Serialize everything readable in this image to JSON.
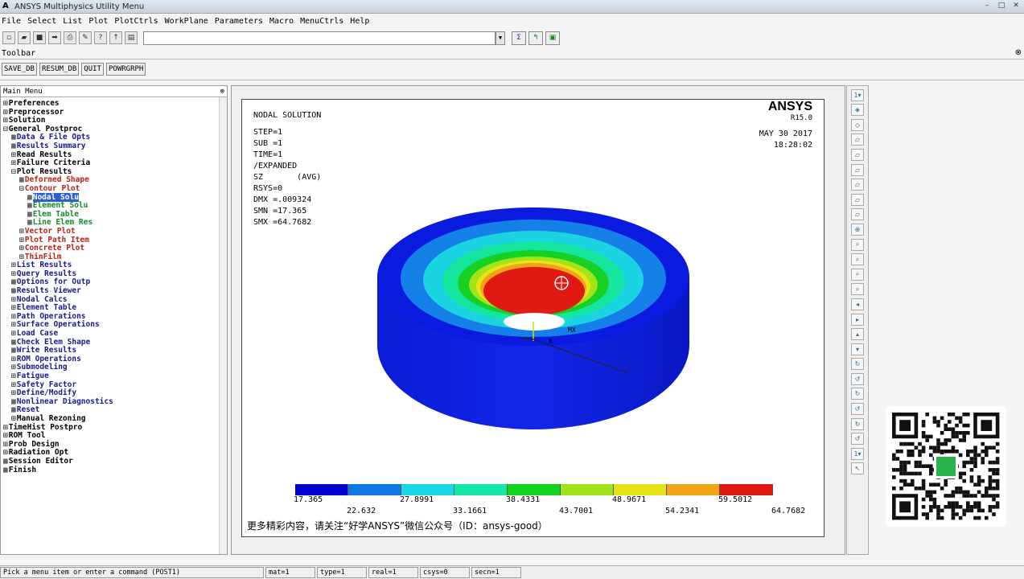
{
  "window": {
    "title": "ANSYS Multiphysics Utility Menu",
    "logo": "A"
  },
  "menubar": [
    "File",
    "Select",
    "List",
    "Plot",
    "PlotCtrls",
    "WorkPlane",
    "Parameters",
    "Macro",
    "MenuCtrls",
    "Help"
  ],
  "toolbar": {
    "label": "Toolbar",
    "buttons": [
      "SAVE_DB",
      "RESUM_DB",
      "QUIT",
      "POWRGRPH"
    ]
  },
  "main_menu": {
    "title": "Main Menu",
    "items": [
      {
        "label": "Preferences",
        "level": 0,
        "prefix": "⊞",
        "style": "c1"
      },
      {
        "label": "Preprocessor",
        "level": 0,
        "prefix": "⊞",
        "style": "c1"
      },
      {
        "label": "Solution",
        "level": 0,
        "prefix": "⊞",
        "style": "c1"
      },
      {
        "label": "General Postproc",
        "level": 0,
        "prefix": "⊟",
        "style": "c1"
      },
      {
        "label": "Data & File Opts",
        "level": 1,
        "prefix": "▦",
        "style": "blue"
      },
      {
        "label": "Results Summary",
        "level": 1,
        "prefix": "▦",
        "style": "blue"
      },
      {
        "label": "Read Results",
        "level": 1,
        "prefix": "⊞",
        "style": "c1"
      },
      {
        "label": "Failure Criteria",
        "level": 1,
        "prefix": "⊞",
        "style": "c1"
      },
      {
        "label": "Plot Results",
        "level": 1,
        "prefix": "⊟",
        "style": "c1"
      },
      {
        "label": "Deformed Shape",
        "level": 2,
        "prefix": "▦",
        "style": "red"
      },
      {
        "label": "Contour Plot",
        "level": 2,
        "prefix": "⊟",
        "style": "red"
      },
      {
        "label": "Nodal Solu",
        "level": 3,
        "prefix": "▦",
        "style": "sel"
      },
      {
        "label": "Element Solu",
        "level": 3,
        "prefix": "▦",
        "style": "green"
      },
      {
        "label": "Elem Table",
        "level": 3,
        "prefix": "▦",
        "style": "green"
      },
      {
        "label": "Line Elem Res",
        "level": 3,
        "prefix": "▦",
        "style": "green"
      },
      {
        "label": "Vector Plot",
        "level": 2,
        "prefix": "⊞",
        "style": "red"
      },
      {
        "label": "Plot Path Item",
        "level": 2,
        "prefix": "⊞",
        "style": "red"
      },
      {
        "label": "Concrete Plot",
        "level": 2,
        "prefix": "⊞",
        "style": "red"
      },
      {
        "label": "ThinFilm",
        "level": 2,
        "prefix": "⊞",
        "style": "red"
      },
      {
        "label": "List Results",
        "level": 1,
        "prefix": "⊞",
        "style": "blue"
      },
      {
        "label": "Query Results",
        "level": 1,
        "prefix": "⊞",
        "style": "blue"
      },
      {
        "label": "Options for Outp",
        "level": 1,
        "prefix": "▦",
        "style": "blue"
      },
      {
        "label": "Results Viewer",
        "level": 1,
        "prefix": "▦",
        "style": "blue"
      },
      {
        "label": "Nodal Calcs",
        "level": 1,
        "prefix": "⊞",
        "style": "blue"
      },
      {
        "label": "Element Table",
        "level": 1,
        "prefix": "⊞",
        "style": "blue"
      },
      {
        "label": "Path Operations",
        "level": 1,
        "prefix": "⊞",
        "style": "blue"
      },
      {
        "label": "Surface Operations",
        "level": 1,
        "prefix": "⊞",
        "style": "blue"
      },
      {
        "label": "Load Case",
        "level": 1,
        "prefix": "⊞",
        "style": "blue"
      },
      {
        "label": "Check Elem Shape",
        "level": 1,
        "prefix": "▦",
        "style": "blue"
      },
      {
        "label": "Write Results",
        "level": 1,
        "prefix": "▦",
        "style": "blue"
      },
      {
        "label": "ROM Operations",
        "level": 1,
        "prefix": "⊞",
        "style": "blue"
      },
      {
        "label": "Submodeling",
        "level": 1,
        "prefix": "⊞",
        "style": "blue"
      },
      {
        "label": "Fatigue",
        "level": 1,
        "prefix": "⊞",
        "style": "blue"
      },
      {
        "label": "Safety Factor",
        "level": 1,
        "prefix": "⊞",
        "style": "blue"
      },
      {
        "label": "Define/Modify",
        "level": 1,
        "prefix": "⊞",
        "style": "blue"
      },
      {
        "label": "Nonlinear Diagnostics",
        "level": 1,
        "prefix": "▦",
        "style": "blue"
      },
      {
        "label": "Reset",
        "level": 1,
        "prefix": "▦",
        "style": "blue"
      },
      {
        "label": "Manual Rezoning",
        "level": 1,
        "prefix": "⊞",
        "style": "c1"
      },
      {
        "label": "TimeHist Postpro",
        "level": 0,
        "prefix": "⊞",
        "style": "c1"
      },
      {
        "label": "ROM Tool",
        "level": 0,
        "prefix": "⊞",
        "style": "c1"
      },
      {
        "label": "Prob Design",
        "level": 0,
        "prefix": "⊞",
        "style": "c1"
      },
      {
        "label": "Radiation Opt",
        "level": 0,
        "prefix": "⊞",
        "style": "c1"
      },
      {
        "label": "Session Editor",
        "level": 0,
        "prefix": "▦",
        "style": "c1"
      },
      {
        "label": "Finish",
        "level": 0,
        "prefix": "▦",
        "style": "c1"
      }
    ]
  },
  "plot": {
    "header": "NODAL SOLUTION",
    "info": [
      "STEP=1",
      "SUB =1",
      "TIME=1",
      "/EXPANDED",
      "SZ       (AVG)",
      "RSYS=0",
      "DMX =.009324",
      "SMN =17.365",
      "SMX =64.7682"
    ],
    "brand": "ANSYS",
    "release": "R15.0",
    "date": "MAY 30 2017",
    "time": "18:28:02",
    "mx_label": "MX",
    "legend_colors": [
      "#0000d0",
      "#0f78e6",
      "#18d8e6",
      "#12e7a8",
      "#12d21e",
      "#9ee41a",
      "#e4e418",
      "#f2a418",
      "#e01a12"
    ],
    "legend_top": [
      "17.365",
      "27.8991",
      "38.4331",
      "48.9671",
      "59.5012"
    ],
    "legend_bottom": [
      "22.632",
      "33.1661",
      "43.7001",
      "54.2341",
      "64.7682"
    ],
    "caption": "更多精彩内容，请关注“好学ANSYS”微信公众号（ID：ansys-good）"
  },
  "status": [
    "Pick a menu item or enter a command (POST1)",
    "mat=1",
    "type=1",
    "real=1",
    "csys=0",
    "secn=1"
  ]
}
